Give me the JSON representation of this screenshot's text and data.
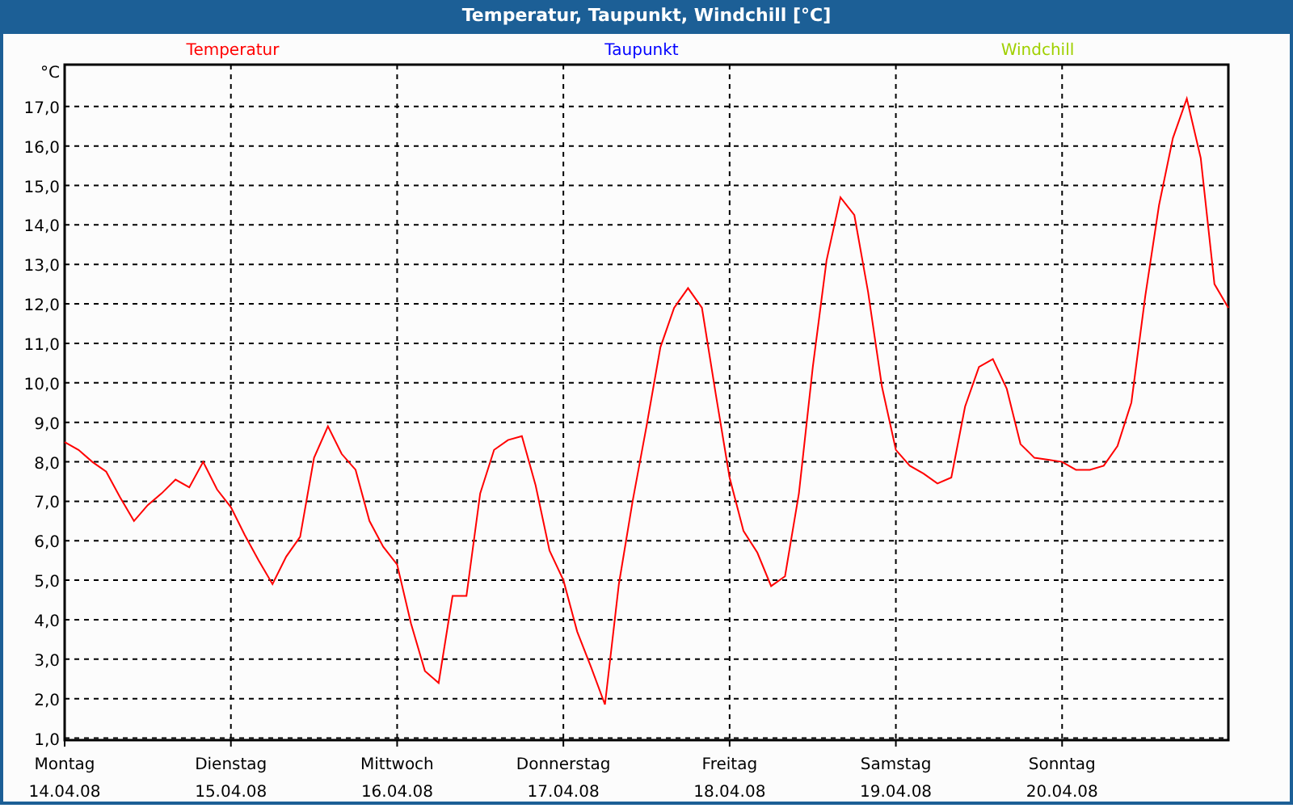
{
  "window": {
    "title": "Temperatur, Taupunkt, Windchill [°C]"
  },
  "legend": [
    {
      "label": "Taupunkt",
      "color": "#0000ff"
    },
    {
      "label": "Windchill",
      "color": "#a0d000"
    }
  ],
  "date_labels": [
    "14.04.08",
    "15.04.08",
    "16.04.08",
    "17.04.08",
    "18.04.08",
    "19.04.08",
    "20.04.08"
  ],
  "chart_data": {
    "type": "line",
    "grid": true,
    "ylabel": "°C",
    "ylim": [
      0.95,
      18.06
    ],
    "yticks": [
      {
        "value": 1,
        "label": "1,0"
      },
      {
        "value": 2,
        "label": "2,0"
      },
      {
        "value": 3,
        "label": "3,0"
      },
      {
        "value": 4,
        "label": "4,0"
      },
      {
        "value": 5,
        "label": "5,0"
      },
      {
        "value": 6,
        "label": "6,0"
      },
      {
        "value": 7,
        "label": "7,0"
      },
      {
        "value": 8,
        "label": "8,0"
      },
      {
        "value": 9,
        "label": "9,0"
      },
      {
        "value": 10,
        "label": "10,0"
      },
      {
        "value": 11,
        "label": "11,0"
      },
      {
        "value": 12,
        "label": "12,0"
      },
      {
        "value": 13,
        "label": "13,0"
      },
      {
        "value": 14,
        "label": "14,0"
      },
      {
        "value": 15,
        "label": "15,0"
      },
      {
        "value": 16,
        "label": "16,0"
      },
      {
        "value": 17,
        "label": "17,0"
      }
    ],
    "categories": [
      "Montag",
      null,
      null,
      null,
      null,
      null,
      null,
      null,
      null,
      null,
      null,
      null,
      "Dienstag",
      null,
      null,
      null,
      null,
      null,
      null,
      null,
      null,
      null,
      null,
      null,
      "Mittwoch",
      null,
      null,
      null,
      null,
      null,
      null,
      null,
      null,
      null,
      null,
      null,
      "Donnerstag",
      null,
      null,
      null,
      null,
      null,
      null,
      null,
      null,
      null,
      null,
      null,
      "Freitag",
      null,
      null,
      null,
      null,
      null,
      null,
      null,
      null,
      null,
      null,
      null,
      "Samstag",
      null,
      null,
      null,
      null,
      null,
      null,
      null,
      null,
      null,
      null,
      null,
      "Sonntag",
      null,
      null,
      null,
      null,
      null,
      null,
      null,
      null,
      null,
      null,
      null,
      null
    ],
    "series": [
      {
        "name": "Temperatur",
        "color": "#ff0000",
        "values": [
          8.5,
          8.3,
          8.0,
          7.75,
          7.1,
          6.5,
          6.9,
          7.2,
          7.55,
          7.35,
          8.0,
          7.3,
          6.85,
          6.15,
          5.5,
          4.9,
          5.6,
          6.1,
          8.1,
          8.9,
          8.2,
          7.8,
          6.5,
          5.85,
          5.4,
          3.9,
          2.7,
          2.4,
          4.6,
          4.6,
          7.2,
          8.3,
          8.55,
          8.65,
          7.4,
          5.75,
          5.0,
          3.7,
          2.8,
          1.85,
          4.9,
          7.0,
          8.9,
          10.9,
          11.9,
          12.4,
          11.9,
          9.7,
          7.6,
          6.25,
          5.7,
          4.85,
          5.1,
          7.2,
          10.4,
          13.1,
          14.7,
          14.25,
          12.3,
          9.9,
          8.3,
          7.9,
          7.7,
          7.45,
          7.6,
          9.4,
          10.4,
          10.6,
          9.85,
          8.45,
          8.1,
          8.05,
          8.0,
          7.8,
          7.8,
          7.9,
          8.4,
          9.5,
          12.2,
          14.5,
          16.2,
          17.2,
          15.7,
          12.5,
          11.9
        ]
      }
    ]
  }
}
